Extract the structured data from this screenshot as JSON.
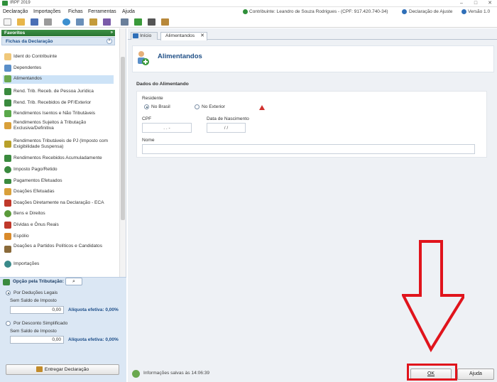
{
  "window": {
    "title": "IRPF 2019"
  },
  "menu": {
    "items": [
      "Declaração",
      "Importações",
      "Fichas",
      "Ferramentas",
      "Ajuda"
    ],
    "contribuinte": "Contribuinte: Leandro de Souza Rodrigues - (CPF: 917.420.740-34)",
    "declaracao_tipo": "Declaração de Ajuste",
    "versao": "Versão 1.0"
  },
  "sidebar": {
    "favoritos": "Favoritos",
    "fichas_title": "Fichas da Declaração",
    "items": [
      "Ident do Contribuinte",
      "Dependentes",
      "Alimentandos",
      "Rend. Trib. Receb. de Pessoa Jurídica",
      "Rend. Trib. Recebidos de PF/Exterior",
      "Rendimentos Isentos e Não Tributáveis",
      "Rendimentos Sujeitos à Tributação Exclusiva/Definitiva",
      "Rendimentos Tributáveis de PJ (Imposto com Exigibilidade Suspensa)",
      "Rendimentos Recebidos Acumuladamente",
      "Imposto Pago/Retido",
      "Pagamentos Efetuados",
      "Doações Efetuadas",
      "Doações Diretamente na Declaração - ECA",
      "Bens e Direitos",
      "Dívidas e Ônus Reais",
      "Espólio",
      "Doações a Partidos Políticos e Candidatos",
      "Importações"
    ],
    "selected_index": 2
  },
  "opcao": {
    "title": "Opção pela Tributação:",
    "deducoes_label": "Por Deduções Legais",
    "deducoes_saldo_label": "Sem Saldo de Imposto",
    "deducoes_valor": "0,00",
    "deducoes_aliquota": "Alíquota efetiva: 0,00%",
    "simplificado_label": "Por Desconto Simplificado",
    "simplificado_saldo_label": "Sem Saldo de Imposto",
    "simplificado_valor": "0,00",
    "simplificado_aliquota": "Alíquota efetiva: 0,00%",
    "entregar_label": "Entregar Declaração"
  },
  "tabs": [
    {
      "label": "Início"
    },
    {
      "label": "Alimentandos"
    }
  ],
  "page": {
    "title": "Alimentandos",
    "section_title": "Dados do Alimentando",
    "residente_label": "Residente",
    "no_brasil_label": "No Brasil",
    "no_exterior_label": "No Exterior",
    "cpf_label": "CPF",
    "cpf_value": ". . -",
    "nascimento_label": "Data de Nascimento",
    "nascimento_value": "/ /",
    "nome_label": "Nome"
  },
  "status": {
    "info": "Informações salvas às 14:06:39",
    "ok_label": "OK",
    "ajuda_label": "Ajuda"
  },
  "colors": {
    "brand_green": "#2f8f3a",
    "header_blue": "#1f4f86",
    "highlight_red": "#e0141c"
  }
}
